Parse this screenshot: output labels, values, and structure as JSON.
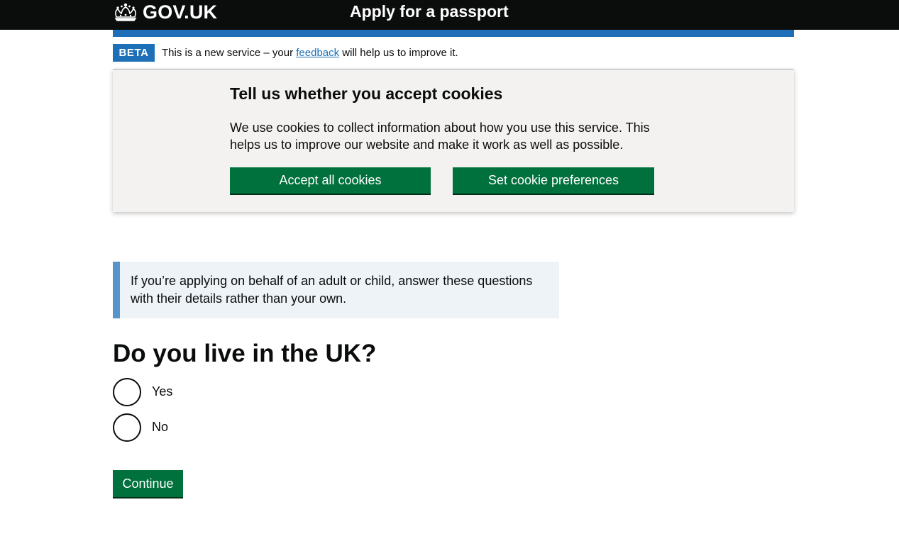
{
  "header": {
    "logo_text": "GOV.UK",
    "service_name": "Apply for a passport"
  },
  "phase_banner": {
    "tag": "BETA",
    "text_before": "This is a new service – your ",
    "link": "feedback",
    "text_after": " will help us to improve it."
  },
  "cookie_banner": {
    "heading": "Tell us whether you accept cookies",
    "body": "We use cookies to collect information about how you use this service. This helps us to improve our website and make it work as well as possible.",
    "accept_label": "Accept all cookies",
    "preferences_label": "Set cookie preferences"
  },
  "inset_text": "If you’re applying on behalf of an adult or child, answer these questions with their details rather than your own.",
  "question": {
    "heading": "Do you live in the UK?",
    "options": [
      {
        "label": "Yes"
      },
      {
        "label": "No"
      }
    ]
  },
  "continue_label": "Continue",
  "colors": {
    "header_bg": "#0b0c0c",
    "brand_blue": "#1d70b8",
    "button_green": "#00703c",
    "cookie_bg": "#f3f2f1",
    "inset_border": "#5694ca",
    "inset_bg": "#eef3f8"
  }
}
